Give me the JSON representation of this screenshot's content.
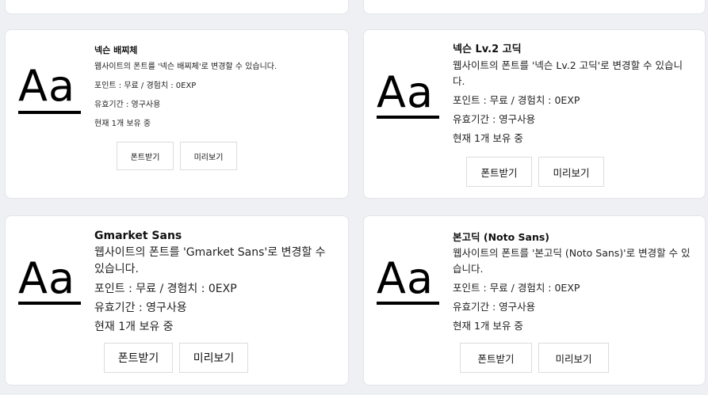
{
  "cards": [
    {
      "title": "넥슨 배찌체",
      "description": "웹사이트의 폰트를 '넥슨 배찌체'로 변경할 수 있습니다.",
      "points": "포인트 : 무료 / 경험치 : 0EXP",
      "period": "유효기간 : 영구사용",
      "owned": "현재 1개 보유 중",
      "sample": "Aa",
      "download_label": "폰트받기",
      "preview_label": "미리보기"
    },
    {
      "title": "넥슨 Lv.2 고딕",
      "description": "웹사이트의 폰트를 '넥슨 Lv.2 고딕'로 변경할 수 있습니다.",
      "points": "포인트 : 무료 / 경험치 : 0EXP",
      "period": "유효기간 : 영구사용",
      "owned": "현재 1개 보유 중",
      "sample": "Aa",
      "download_label": "폰트받기",
      "preview_label": "미리보기"
    },
    {
      "title": "Gmarket Sans",
      "description": "웹사이트의 폰트를 'Gmarket Sans'로 변경할 수 있습니다.",
      "points": "포인트 : 무료 / 경험치 : 0EXP",
      "period": "유효기간 : 영구사용",
      "owned": "현재 1개 보유 중",
      "sample": "Aa",
      "download_label": "폰트받기",
      "preview_label": "미리보기"
    },
    {
      "title": "본고딕 (Noto Sans)",
      "description": "웹사이트의 폰트를 '본고딕 (Noto Sans)'로 변경할 수 있습니다.",
      "points": "포인트 : 무료 / 경험치 : 0EXP",
      "period": "유효기간 : 영구사용",
      "owned": "현재 1개 보유 중",
      "sample": "Aa",
      "download_label": "폰트받기",
      "preview_label": "미리보기"
    }
  ]
}
